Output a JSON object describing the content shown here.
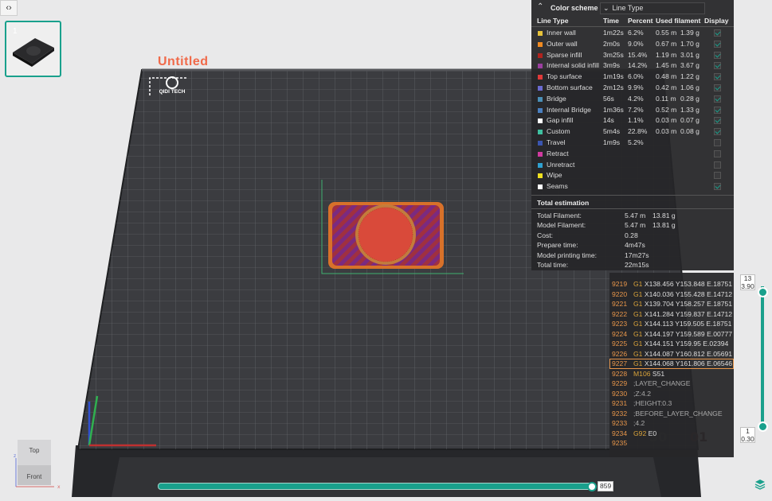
{
  "window": {
    "title": "Untitled"
  },
  "plate": {
    "index": "1",
    "brand": "QIDI TECH"
  },
  "legend": {
    "scheme_label": "Color scheme",
    "scheme_value": "Line Type",
    "columns": [
      "Line Type",
      "Time",
      "Percent",
      "Used filament",
      "Display"
    ],
    "rows": [
      {
        "name": "Inner wall",
        "color": "#e7c23a",
        "time": "1m22s",
        "percent": "6.2%",
        "length": "0.55 m",
        "weight": "1.39 g",
        "display": true
      },
      {
        "name": "Outer wall",
        "color": "#f08a21",
        "time": "2m0s",
        "percent": "9.0%",
        "length": "0.67 m",
        "weight": "1.70 g",
        "display": true
      },
      {
        "name": "Sparse infill",
        "color": "#b0231e",
        "time": "3m25s",
        "percent": "15.4%",
        "length": "1.19 m",
        "weight": "3.01 g",
        "display": true
      },
      {
        "name": "Internal solid infill",
        "color": "#9b3fa0",
        "time": "3m9s",
        "percent": "14.2%",
        "length": "1.45 m",
        "weight": "3.67 g",
        "display": true
      },
      {
        "name": "Top surface",
        "color": "#e03a3a",
        "time": "1m19s",
        "percent": "6.0%",
        "length": "0.48 m",
        "weight": "1.22 g",
        "display": true
      },
      {
        "name": "Bottom surface",
        "color": "#6a6ad0",
        "time": "2m12s",
        "percent": "9.9%",
        "length": "0.42 m",
        "weight": "1.06 g",
        "display": true
      },
      {
        "name": "Bridge",
        "color": "#4a8fb7",
        "time": "56s",
        "percent": "4.2%",
        "length": "0.11 m",
        "weight": "0.28 g",
        "display": true
      },
      {
        "name": "Internal Bridge",
        "color": "#4a7fc0",
        "time": "1m36s",
        "percent": "7.2%",
        "length": "0.52 m",
        "weight": "1.33 g",
        "display": true
      },
      {
        "name": "Gap infill",
        "color": "#ffffff",
        "time": "14s",
        "percent": "1.1%",
        "length": "0.03 m",
        "weight": "0.07 g",
        "display": true
      },
      {
        "name": "Custom",
        "color": "#3fc0a0",
        "time": "5m4s",
        "percent": "22.8%",
        "length": "0.03 m",
        "weight": "0.08 g",
        "display": true
      },
      {
        "name": "Travel",
        "color": "#3a55b0",
        "time": "1m9s",
        "percent": "5.2%",
        "length": "",
        "weight": "",
        "display": false
      },
      {
        "name": "Retract",
        "color": "#d03aa0",
        "time": "",
        "percent": "",
        "length": "",
        "weight": "",
        "display": false
      },
      {
        "name": "Unretract",
        "color": "#2fa0d0",
        "time": "",
        "percent": "",
        "length": "",
        "weight": "",
        "display": false
      },
      {
        "name": "Wipe",
        "color": "#f0e020",
        "time": "",
        "percent": "",
        "length": "",
        "weight": "",
        "display": false
      },
      {
        "name": "Seams",
        "color": "#ffffff",
        "time": "",
        "percent": "",
        "length": "",
        "weight": "",
        "display": true
      }
    ]
  },
  "estimation": {
    "title": "Total estimation",
    "rows": [
      {
        "label": "Total Filament:",
        "v1": "5.47 m",
        "v2": "13.81 g"
      },
      {
        "label": "Model Filament:",
        "v1": "5.47 m",
        "v2": "13.81 g"
      },
      {
        "label": "Cost:",
        "v1": "0.28",
        "v2": ""
      },
      {
        "label": "Prepare time:",
        "v1": "4m47s",
        "v2": ""
      },
      {
        "label": "Model printing time:",
        "v1": "17m27s",
        "v2": ""
      },
      {
        "label": "Total time:",
        "v1": "22m15s",
        "v2": ""
      }
    ]
  },
  "gcode": {
    "selected_line": "9227",
    "lines": [
      {
        "num": "9219",
        "cmd": "G1",
        "args": "X138.456 Y153.848 E.18751",
        "comment": false
      },
      {
        "num": "9220",
        "cmd": "G1",
        "args": "X140.036 Y155.428 E.14712",
        "comment": false
      },
      {
        "num": "9221",
        "cmd": "G1",
        "args": "X139.704 Y158.257 E.18751",
        "comment": false
      },
      {
        "num": "9222",
        "cmd": "G1",
        "args": "X141.284 Y159.837 E.14712",
        "comment": false
      },
      {
        "num": "9223",
        "cmd": "G1",
        "args": "X144.113 Y159.505 E.18751",
        "comment": false
      },
      {
        "num": "9224",
        "cmd": "G1",
        "args": "X144.197 Y159.589 E.00777",
        "comment": false
      },
      {
        "num": "9225",
        "cmd": "G1",
        "args": "X144.151 Y159.95 E.02394",
        "comment": false
      },
      {
        "num": "9226",
        "cmd": "G1",
        "args": "X144.087 Y160.812 E.05691",
        "comment": false
      },
      {
        "num": "9227",
        "cmd": "G1",
        "args": "X144.068 Y161.806 E.06546",
        "comment": false
      },
      {
        "num": "9228",
        "cmd": "M106",
        "args": "S51",
        "comment": false
      },
      {
        "num": "9229",
        "cmd": "",
        "args": ";LAYER_CHANGE",
        "comment": true
      },
      {
        "num": "9230",
        "cmd": "",
        "args": ";Z:4.2",
        "comment": true
      },
      {
        "num": "9231",
        "cmd": "",
        "args": ";HEIGHT:0.3",
        "comment": true
      },
      {
        "num": "9232",
        "cmd": "",
        "args": ";BEFORE_LAYER_CHANGE",
        "comment": true
      },
      {
        "num": "9233",
        "cmd": "",
        "args": ";4.2",
        "comment": true
      },
      {
        "num": "9234",
        "cmd": "G92",
        "args": "E0",
        "comment": false
      },
      {
        "num": "9235",
        "cmd": "",
        "args": "",
        "comment": false
      }
    ]
  },
  "layer_slider": {
    "top_layer": "13",
    "top_height": "3.90",
    "bottom_layer": "1",
    "bottom_height": "0.30"
  },
  "move_slider": {
    "value": "859"
  },
  "view_cube": {
    "top": "Top",
    "front": "Front"
  },
  "colors": {
    "accent": "#19a08c",
    "plate_bg": "#3f4044",
    "print_outer": "#e07a2a",
    "print_fill": "#8a2d7a",
    "title": "#f06a4a"
  },
  "icons": [
    "collapse-icon",
    "chevron-up-icon",
    "chevron-down-icon",
    "layers-icon",
    "check-icon"
  ]
}
